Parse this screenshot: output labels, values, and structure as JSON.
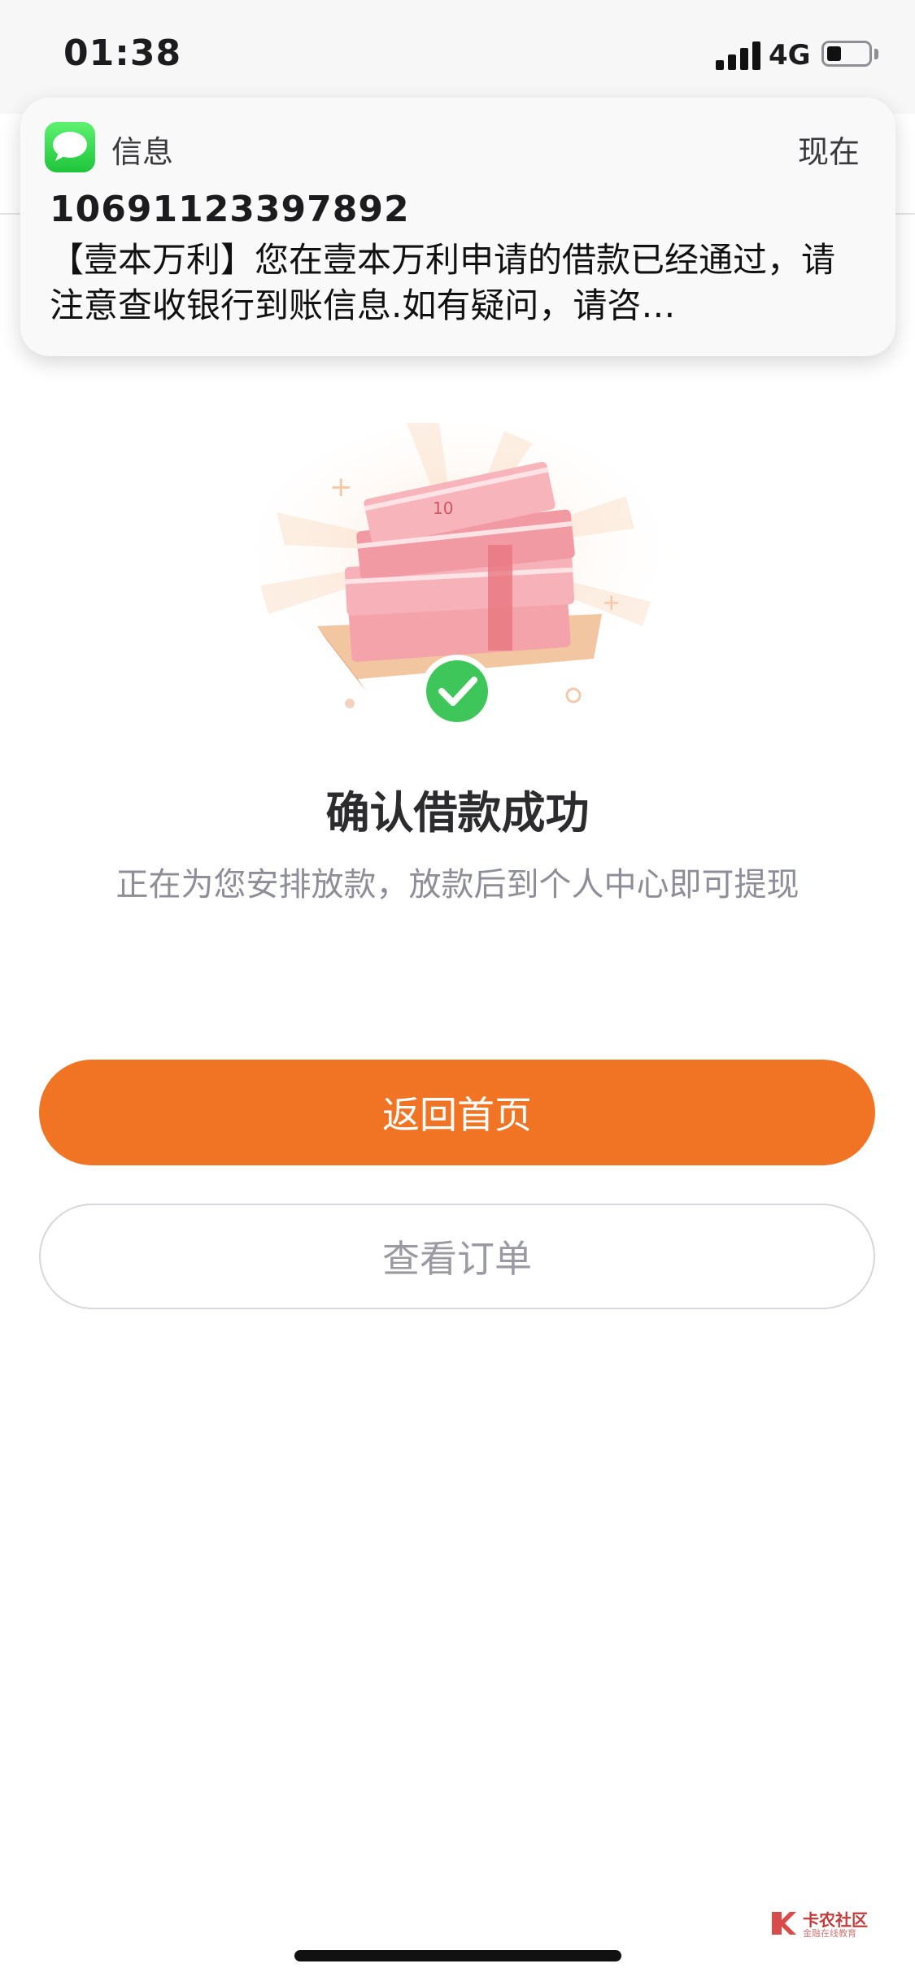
{
  "status_bar": {
    "time": "01:38",
    "network": "4G"
  },
  "notification": {
    "app_name": "信息",
    "time": "现在",
    "sender": "10691123397892",
    "message": "【壹本万利】您在壹本万利申请的借款已经通过，请注意查收银行到账信息.如有疑问，请咨…"
  },
  "illustration": {
    "icon": "money-stack-success-icon",
    "bill_denomination": "10"
  },
  "result": {
    "title": "确认借款成功",
    "subtitle": "正在为您安排放款，放款后到个人中心即可提现"
  },
  "buttons": {
    "primary_label": "返回首页",
    "secondary_label": "查看订单"
  },
  "watermark": {
    "text": "卡农社区",
    "subtext": "金融在线教育"
  },
  "colors": {
    "accent": "#f07423",
    "success": "#3ec65a",
    "message_app": "#2fd44a"
  }
}
